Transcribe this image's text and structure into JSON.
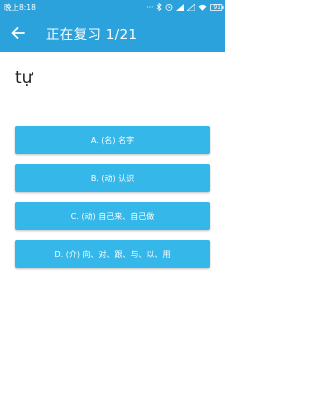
{
  "status": {
    "time": "晚上8:18",
    "battery": "91"
  },
  "header": {
    "title": "正在复习 1/21"
  },
  "word": "tự",
  "options": [
    {
      "label": "A. (名) 名字"
    },
    {
      "label": "B. (动) 认识"
    },
    {
      "label": "C. (动) 自己来、自己做"
    },
    {
      "label": "D. (介) 向、对、跟、与、以、用"
    }
  ],
  "colors": {
    "primary": "#2ba2dc",
    "option_bg": "#35b7ea"
  }
}
